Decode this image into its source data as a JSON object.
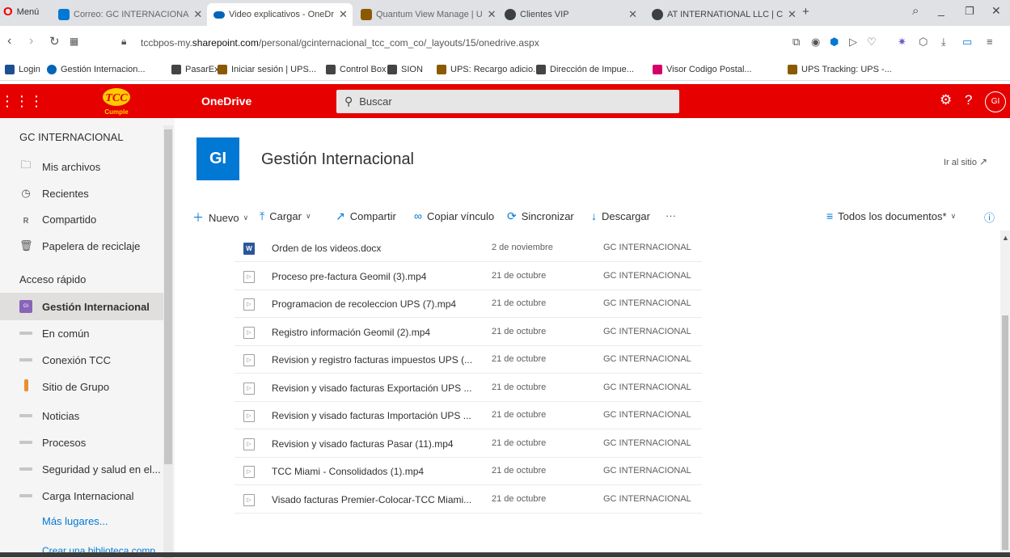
{
  "browser": {
    "menu_label": "Menú",
    "tabs": [
      {
        "label": "Correo: GC INTERNACIONA",
        "color": "#0078d4"
      },
      {
        "label": "Video explicativos - OneDr",
        "color": "#0364b8"
      },
      {
        "label": "Quantum View Manage | U",
        "color": "#8b5a00"
      },
      {
        "label": "Clientes VIP",
        "color": "#3c4043"
      },
      {
        "label": "AT INTERNATIONAL LLC | C",
        "color": "#3c4043"
      }
    ],
    "url_prefix": "tccbpos-my.",
    "url_domain": "sharepoint.com",
    "url_path": "/personal/gcinternacional_tcc_com_co/_layouts/15/onedrive.aspx",
    "bookmarks": [
      "Login",
      "Gestión Internacion...",
      "PasarEx",
      "Iniciar sesión | UPS...",
      "Control Box",
      "SION",
      "UPS: Recargo adicio...",
      "Dirección de Impue...",
      "Visor Codigo Postal...",
      "UPS Tracking: UPS -..."
    ]
  },
  "suite": {
    "app_name": "OneDrive",
    "search_placeholder": "Buscar",
    "avatar_initials": "GI",
    "logo_top": "TCC",
    "logo_bottom": "Cumple"
  },
  "leftnav": {
    "owner": "GC INTERNACIONAL",
    "items": [
      {
        "label": "Mis archivos",
        "icon": "folder-icon"
      },
      {
        "label": "Recientes",
        "icon": "clock-icon"
      },
      {
        "label": "Compartido",
        "icon": "people-icon"
      },
      {
        "label": "Papelera de reciclaje",
        "icon": "recycle-bin-icon"
      }
    ],
    "quick_access_heading": "Acceso rápido",
    "quick_access": [
      "Gestión Internacional",
      "En común",
      "Conexión TCC",
      "Sitio de Grupo",
      "Noticias",
      "Procesos",
      "Seguridad y salud en el...",
      "Carga Internacional"
    ],
    "more_places": "Más lugares...",
    "create_library": "Crear una biblioteca comp..."
  },
  "site": {
    "tile_initials": "GI",
    "title": "Gestión Internacional",
    "go_to_site": "Ir al sitio"
  },
  "commands": {
    "new": "Nuevo",
    "upload": "Cargar",
    "share": "Compartir",
    "copy_link": "Copiar vínculo",
    "sync": "Sincronizar",
    "download": "Descargar",
    "more": "···",
    "view": "Todos los documentos*"
  },
  "files": [
    {
      "name": "Orden de los videos.docx",
      "date": "2 de noviembre",
      "modified_by": "GC INTERNACIONAL",
      "type": "docx"
    },
    {
      "name": "Proceso pre-factura Geomil (3).mp4",
      "date": "21 de octubre",
      "modified_by": "GC INTERNACIONAL",
      "type": "mp4"
    },
    {
      "name": "Programacion de recoleccion UPS (7).mp4",
      "date": "21 de octubre",
      "modified_by": "GC INTERNACIONAL",
      "type": "mp4"
    },
    {
      "name": "Registro información Geomil (2).mp4",
      "date": "21 de octubre",
      "modified_by": "GC INTERNACIONAL",
      "type": "mp4"
    },
    {
      "name": "Revision y registro facturas impuestos UPS (...",
      "date": "21 de octubre",
      "modified_by": "GC INTERNACIONAL",
      "type": "mp4"
    },
    {
      "name": "Revision y visado facturas Exportación UPS ...",
      "date": "21 de octubre",
      "modified_by": "GC INTERNACIONAL",
      "type": "mp4"
    },
    {
      "name": "Revision y visado facturas Importación UPS ...",
      "date": "21 de octubre",
      "modified_by": "GC INTERNACIONAL",
      "type": "mp4"
    },
    {
      "name": "Revision y visado facturas Pasar (11).mp4",
      "date": "21 de octubre",
      "modified_by": "GC INTERNACIONAL",
      "type": "mp4"
    },
    {
      "name": "TCC Miami - Consolidados (1).mp4",
      "date": "21 de octubre",
      "modified_by": "GC INTERNACIONAL",
      "type": "mp4"
    },
    {
      "name": "Visado facturas Premier-Colocar-TCC Miami...",
      "date": "21 de octubre",
      "modified_by": "GC INTERNACIONAL",
      "type": "mp4"
    }
  ],
  "colors": {
    "suite_red": "#e60000",
    "accent_blue": "#0078d4"
  }
}
